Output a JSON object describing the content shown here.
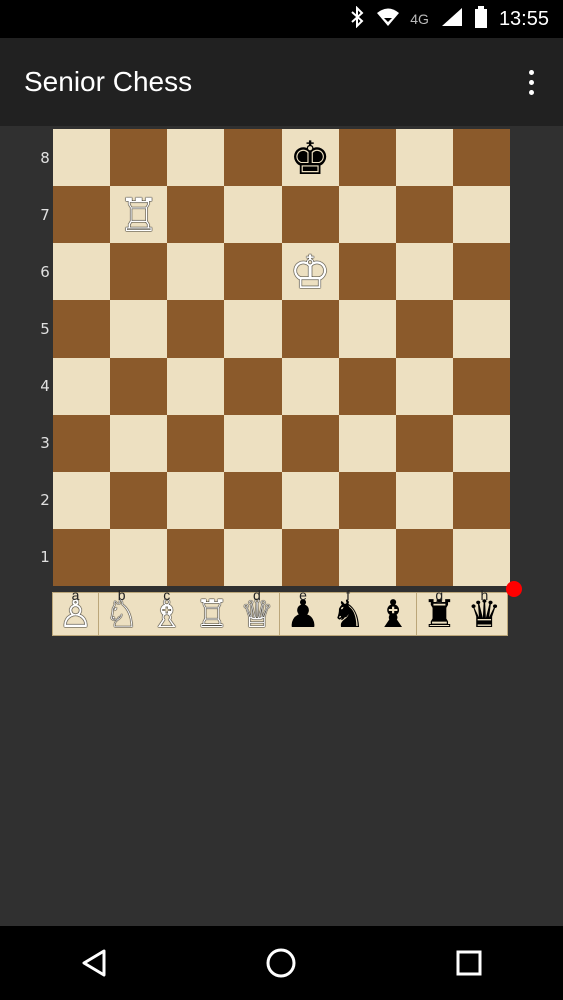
{
  "status_bar": {
    "bluetooth_icon": "bluetooth-icon",
    "wifi_icon": "wifi-icon",
    "network": "4G",
    "signal_icon": "signal-icon",
    "battery_icon": "battery-icon",
    "time": "13:55"
  },
  "app_bar": {
    "title": "Senior Chess",
    "menu_icon": "overflow-menu-icon"
  },
  "board": {
    "ranks": [
      "8",
      "7",
      "6",
      "5",
      "4",
      "3",
      "2",
      "1"
    ],
    "files": [
      "a",
      "b",
      "c",
      "d",
      "e",
      "f",
      "g",
      "h"
    ],
    "pieces": [
      {
        "square": "e8",
        "piece": "black-king",
        "glyph": "♚"
      },
      {
        "square": "b7",
        "piece": "white-rook",
        "glyph": "♖"
      },
      {
        "square": "e6",
        "piece": "white-king",
        "glyph": "♔"
      }
    ],
    "light_color": "#ede0c1",
    "dark_color": "#8b5a2b"
  },
  "piece_tray": [
    {
      "file": "a",
      "piece": "white-pawn",
      "glyph": "♙"
    },
    {
      "file": "b",
      "piece": "white-knight",
      "glyph": "♘"
    },
    {
      "file": "c",
      "piece": "white-bishop",
      "glyph": "♗"
    },
    {
      "file": "",
      "piece": "white-rook",
      "glyph": "♖"
    },
    {
      "file": "d",
      "piece": "white-queen",
      "glyph": "♕"
    },
    {
      "file": "e",
      "piece": "black-pawn",
      "glyph": "♟"
    },
    {
      "file": "f",
      "piece": "black-knight",
      "glyph": "♞"
    },
    {
      "file": "",
      "piece": "black-bishop",
      "glyph": "♝"
    },
    {
      "file": "g",
      "piece": "black-rook",
      "glyph": "♜"
    },
    {
      "file": "h",
      "piece": "black-queen",
      "glyph": "♛"
    }
  ],
  "indicator_color": "#ff0000",
  "nav_bar": {
    "back_icon": "back-icon",
    "home_icon": "home-icon",
    "recents_icon": "recents-icon"
  }
}
